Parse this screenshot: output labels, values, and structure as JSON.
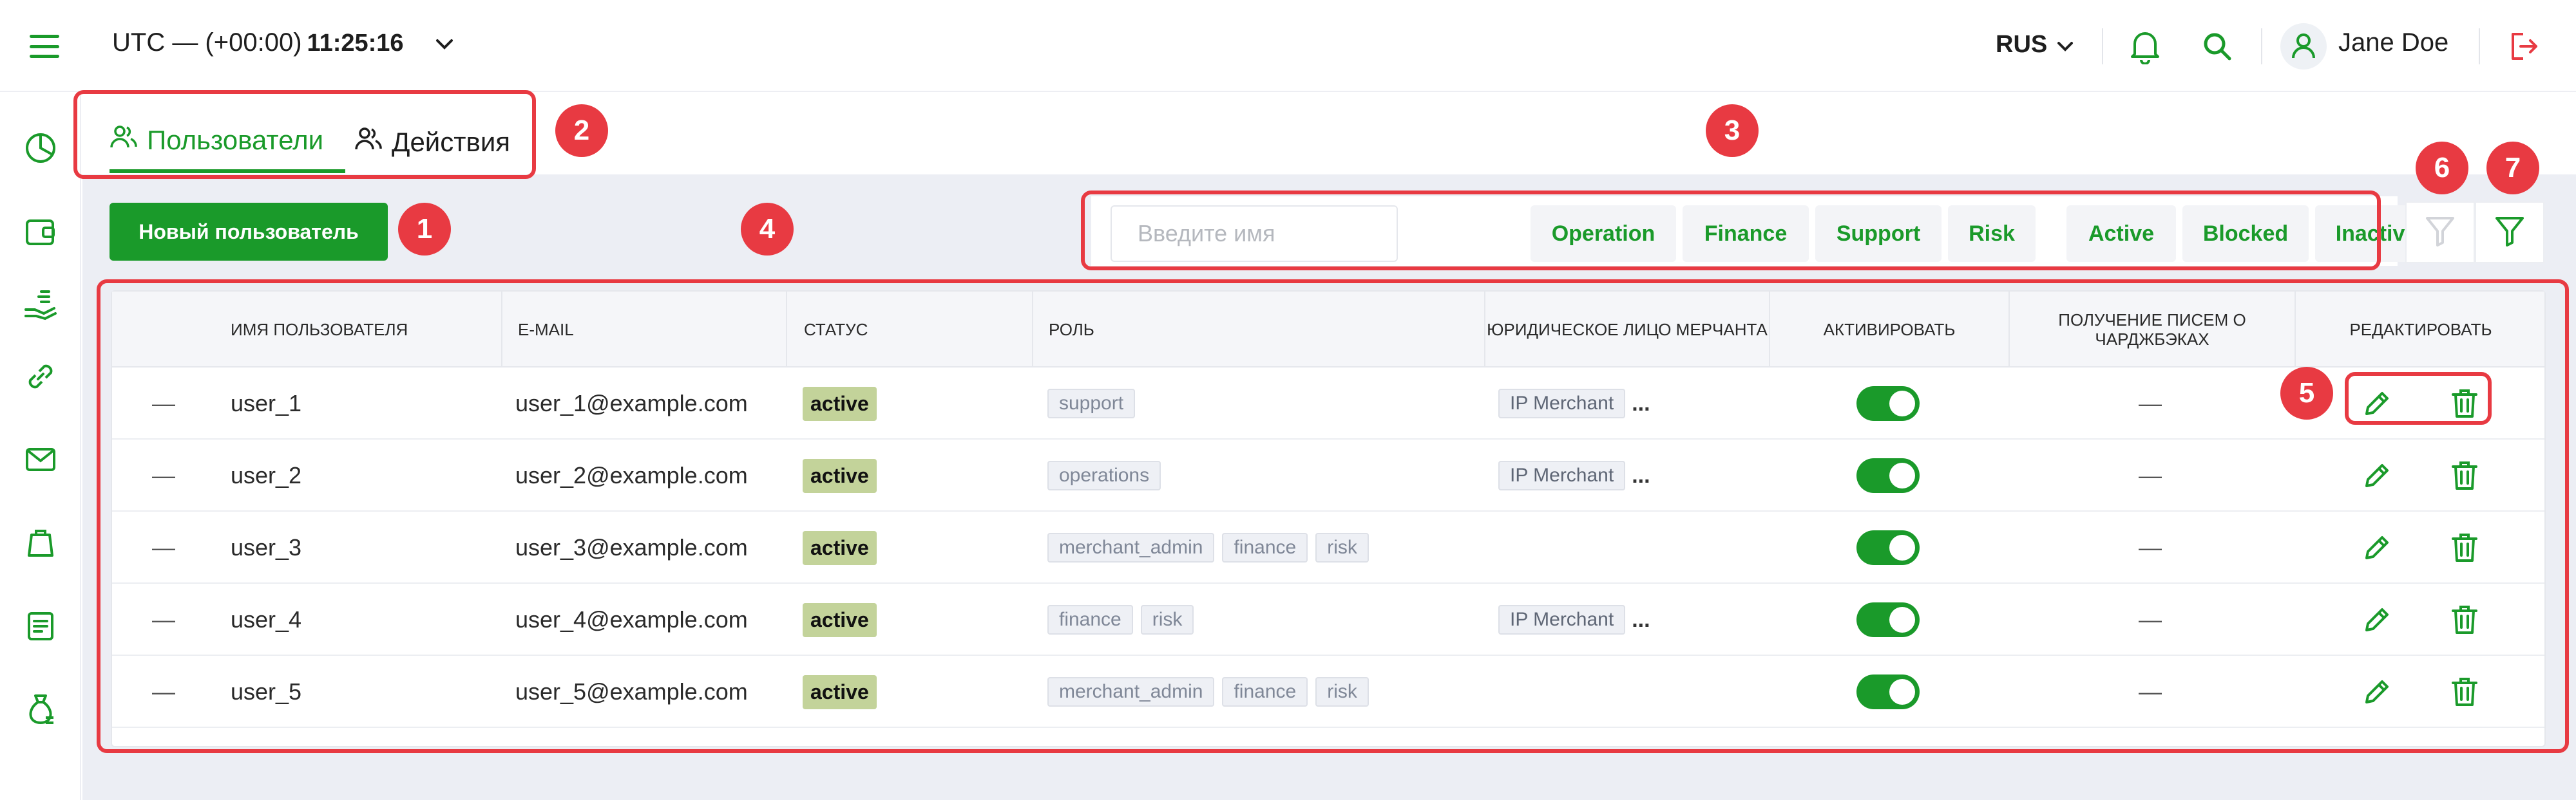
{
  "header": {
    "timezone": "UTC — (+00:00)",
    "clock": "11:25:16",
    "language": "RUS",
    "user_name": "Jane Doe"
  },
  "sidebar": {
    "items": [
      {
        "icon": "pie-chart-icon"
      },
      {
        "icon": "wallet-icon"
      },
      {
        "icon": "money-hand-icon"
      },
      {
        "icon": "link-icon"
      },
      {
        "icon": "mail-icon"
      },
      {
        "icon": "bag-icon"
      },
      {
        "icon": "document-icon"
      },
      {
        "icon": "money-bag-icon"
      }
    ]
  },
  "tabs": [
    {
      "label": "Пользователи",
      "active": true
    },
    {
      "label": "Действия",
      "active": false
    }
  ],
  "toolbar": {
    "new_user_label": "Новый пользователь",
    "search_placeholder": "Введите имя",
    "role_filters": [
      "Operation",
      "Finance",
      "Support",
      "Risk"
    ],
    "status_filters": [
      "Active",
      "Blocked",
      "Inactive"
    ]
  },
  "table": {
    "columns": {
      "username": "ИМЯ ПОЛЬЗОВАТЕЛЯ",
      "email": "E-MAIL",
      "status": "СТАТУС",
      "role": "РОЛЬ",
      "merchant": "ЮРИДИЧЕСКОЕ ЛИЦО МЕРЧАНТА",
      "activate": "АКТИВИРОВАТЬ",
      "chargeback": "ПОЛУЧЕНИЕ ПИСЕМ О ЧАРДЖБЭКАХ",
      "edit": "РЕДАКТИРОВАТЬ"
    },
    "rows": [
      {
        "lead": "—",
        "username": "user_1",
        "email": "user_1@example.com",
        "status": "active",
        "roles": [
          "support"
        ],
        "merchant": "IP Merchant",
        "more": "...",
        "chargeback": "—",
        "active": true
      },
      {
        "lead": "—",
        "username": "user_2",
        "email": "user_2@example.com",
        "status": "active",
        "roles": [
          "operations"
        ],
        "merchant": "IP Merchant",
        "more": "...",
        "chargeback": "—",
        "active": true
      },
      {
        "lead": "—",
        "username": "user_3",
        "email": "user_3@example.com",
        "status": "active",
        "roles": [
          "merchant_admin",
          "finance",
          "risk"
        ],
        "merchant": "",
        "more": "",
        "chargeback": "—",
        "active": true
      },
      {
        "lead": "—",
        "username": "user_4",
        "email": "user_4@example.com",
        "status": "active",
        "roles": [
          "finance",
          "risk"
        ],
        "merchant": "IP Merchant",
        "more": "...",
        "chargeback": "—",
        "active": true
      },
      {
        "lead": "—",
        "username": "user_5",
        "email": "user_5@example.com",
        "status": "active",
        "roles": [
          "merchant_admin",
          "finance",
          "risk"
        ],
        "merchant": "",
        "more": "",
        "chargeback": "—",
        "active": true
      }
    ]
  },
  "annotations": [
    "1",
    "2",
    "3",
    "4",
    "5",
    "6",
    "7"
  ],
  "colors": {
    "accent": "#1a9a2a",
    "annotation": "#e83a42",
    "status_badge": "#c3d39a",
    "background": "#eceef4"
  }
}
